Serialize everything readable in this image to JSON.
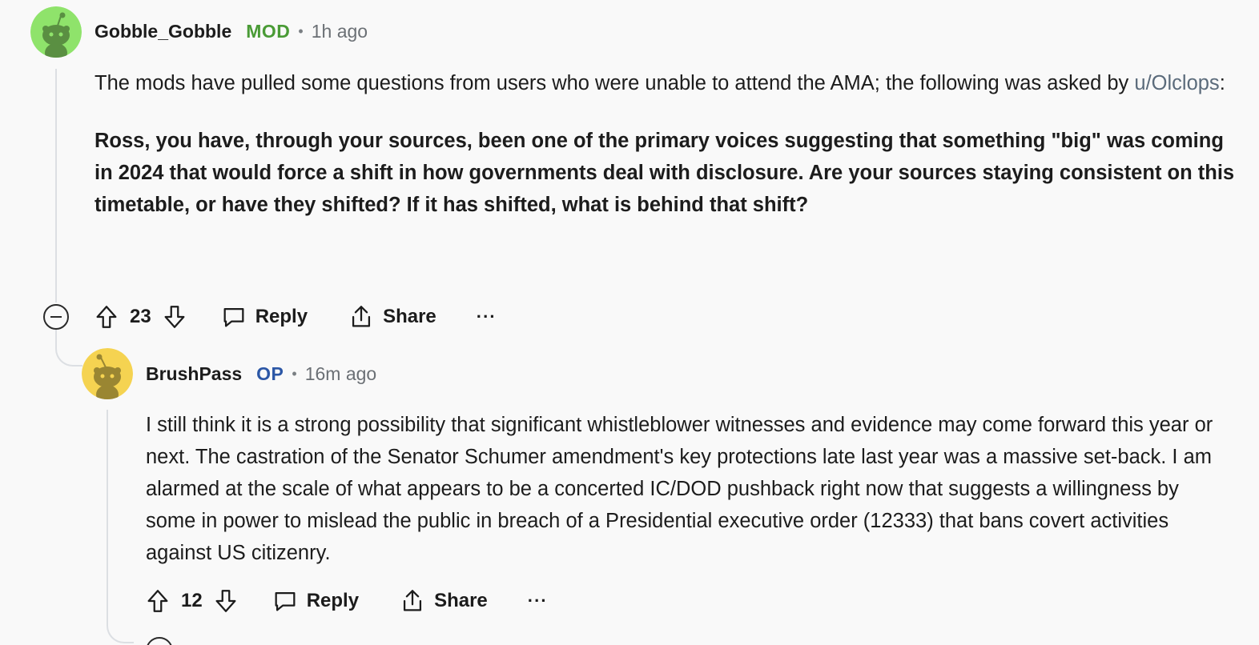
{
  "comments": [
    {
      "username": "Gobble_Gobble",
      "badge": "MOD",
      "separator": "•",
      "time": "1h ago",
      "avatar_color": "#8fe36b",
      "intro_before": "The mods have pulled some questions from users who were unable to attend the AMA; the following was asked by ",
      "intro_user": "u/Olclops",
      "intro_after": ":",
      "question": "Ross, you have, through your sources, been one of the primary voices suggesting that something \"big\" was coming in 2024 that would force a shift in how governments deal with disclosure. Are your sources staying consistent on this timetable, or have they shifted? If it has shifted, what is behind that shift?",
      "votes": "23",
      "reply_label": "Reply",
      "share_label": "Share",
      "more_label": "···"
    },
    {
      "username": "BrushPass",
      "badge": "OP",
      "separator": "•",
      "time": "16m ago",
      "avatar_color": "#f5d351",
      "body": "I still think it is a strong possibility that significant whistleblower witnesses and evidence may come forward this year or next. The castration of the Senator Schumer amendment's key protections late last year was a massive set-back. I am alarmed at the scale of what appears to be a concerted IC/DOD pushback right now that suggests a willingness by some in power to mislead the public in breach of a Presidential executive order (12333) that bans covert activities against US citizenry.",
      "votes": "12",
      "reply_label": "Reply",
      "share_label": "Share",
      "more_label": "···"
    }
  ],
  "colors": {
    "mod_badge": "#4a9b36",
    "op_badge": "#2c57a6",
    "thread_line": "#dcdfe3",
    "background": "#f9f9f9"
  },
  "icons": [
    "upvote-icon",
    "downvote-icon",
    "comment-icon",
    "share-icon",
    "more-icon",
    "collapse-icon"
  ]
}
